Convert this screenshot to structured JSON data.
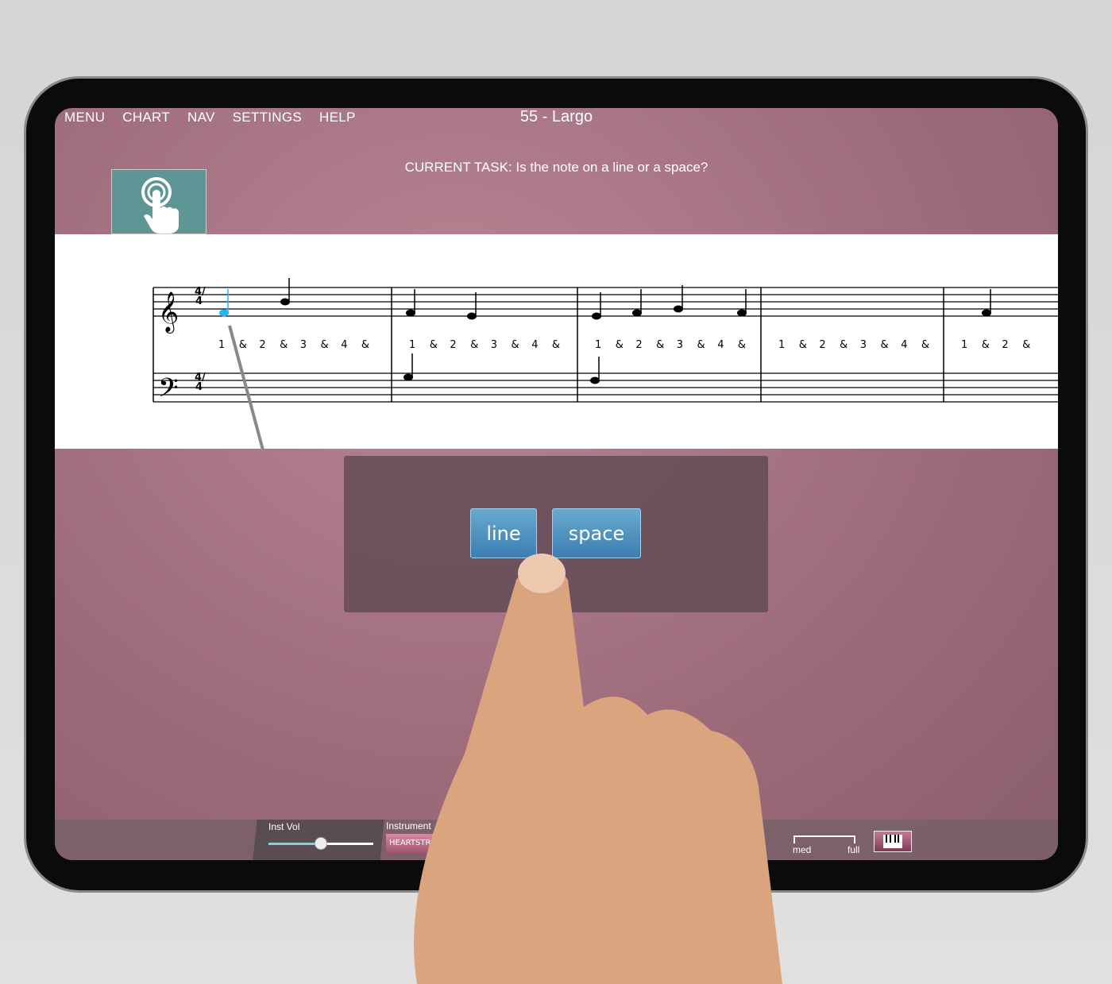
{
  "menu": {
    "items": [
      "MENU",
      "CHART",
      "NAV",
      "SETTINGS",
      "HELP"
    ]
  },
  "header": {
    "title": "55 - Largo",
    "task": "CURRENT TASK: Is the note on a line or a space?"
  },
  "task_icon": "tap-hand-icon",
  "score": {
    "time_signature": "4/4",
    "measures": [
      {
        "beats": [
          "1",
          "&",
          "2",
          "&",
          "3",
          "&",
          "4",
          "&"
        ]
      },
      {
        "beats": [
          "1",
          "&",
          "2",
          "&",
          "3",
          "&",
          "4",
          "&"
        ]
      },
      {
        "beats": [
          "1",
          "&",
          "2",
          "&",
          "3",
          "&",
          "4",
          "&"
        ]
      },
      {
        "beats": [
          "1",
          "&",
          "2",
          "&",
          "3",
          "&",
          "4",
          "&"
        ]
      },
      {
        "beats": [
          "1",
          "&",
          "2",
          "&"
        ]
      }
    ],
    "highlight_color": "#2bb3f0"
  },
  "dialog": {
    "buttons": [
      "line",
      "space"
    ]
  },
  "bottom": {
    "inst_vol_label": "Inst Vol",
    "inst_vol_value": 0.5,
    "instrument_label": "Instrument",
    "instrument_value": "HEARTSTRINGS ORCH",
    "level_labels": [
      "med",
      "full"
    ],
    "piano_icon": "piano-keys-icon"
  },
  "colors": {
    "accent": "#5e9695",
    "button": "#3b7fb0",
    "background": "#9c6b7a"
  }
}
